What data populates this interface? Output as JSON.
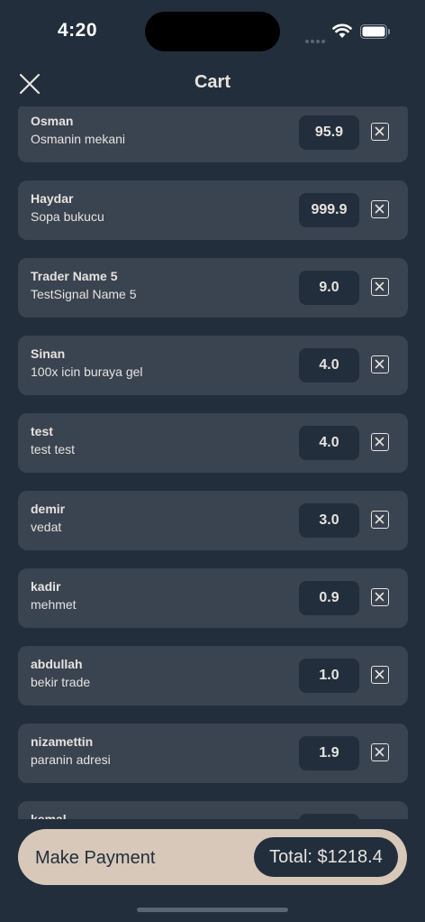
{
  "status_bar": {
    "time": "4:20"
  },
  "nav": {
    "title": "Cart",
    "close_icon": "close-icon"
  },
  "cart": {
    "items": [
      {
        "trader": "Osman",
        "signal": "Osmanin mekani",
        "price": "95.9"
      },
      {
        "trader": "Haydar",
        "signal": "Sopa bukucu",
        "price": "999.9"
      },
      {
        "trader": "Trader Name 5",
        "signal": "TestSignal Name 5",
        "price": "9.0"
      },
      {
        "trader": "Sinan",
        "signal": "100x icin buraya gel",
        "price": "4.0"
      },
      {
        "trader": "test",
        "signal": "test test",
        "price": "4.0"
      },
      {
        "trader": "demir",
        "signal": "vedat",
        "price": "3.0"
      },
      {
        "trader": "kadir",
        "signal": "mehmet",
        "price": "0.9"
      },
      {
        "trader": "abdullah",
        "signal": "bekir trade",
        "price": "1.0"
      },
      {
        "trader": "nizamettin",
        "signal": "paranin adresi",
        "price": "1.9"
      },
      {
        "trader": "kemal",
        "signal": "",
        "price": ""
      }
    ]
  },
  "payment": {
    "label": "Make Payment",
    "total": "Total: $1218.4"
  },
  "colors": {
    "background": "#222e3b",
    "card": "#3a4350",
    "accent": "#d8c8ba",
    "text": "#e6e3df"
  }
}
